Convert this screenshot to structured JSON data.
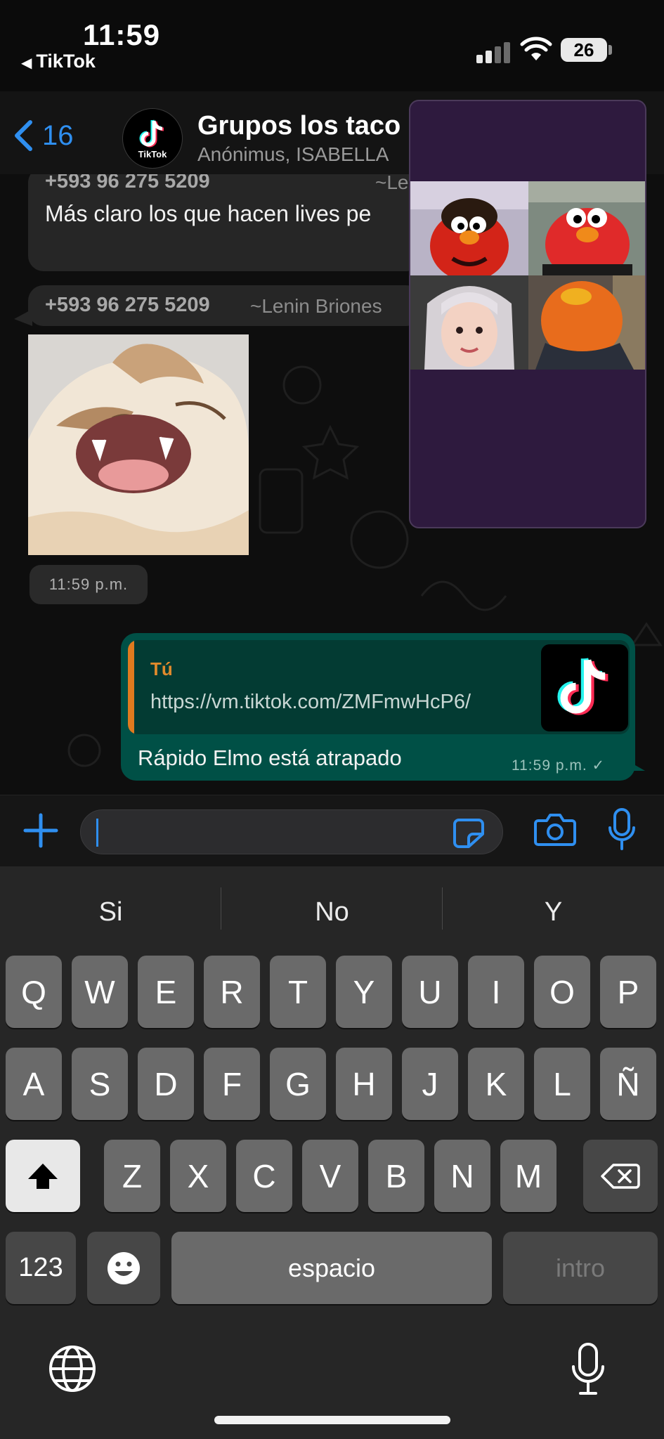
{
  "status_bar": {
    "time": "11:59",
    "back_app": "TikTok",
    "battery": "26"
  },
  "header": {
    "back_count": "16",
    "avatar_label": "TikTok",
    "title": "Grupos los taco",
    "subtitle": "Anónimus, ISABELLA"
  },
  "messages": {
    "msg1": {
      "sender": "+593 96 275 5209",
      "sender_name": "~Le",
      "text": "Más claro los que hacen lives pe"
    },
    "msg2": {
      "sender": "+593 96 275 5209",
      "sender_name": "~Lenin Briones"
    },
    "sticker_time": "11:59 p.m.",
    "outgoing": {
      "quote_author": "Tú",
      "quote_link": "https://vm.tiktok.com/ZMFmwHcP6/",
      "text": "Rápido Elmo está atrapado",
      "time": "11:59 p.m. ✓"
    }
  },
  "keyboard": {
    "suggestions": [
      "Si",
      "No",
      "Y"
    ],
    "row1": [
      "Q",
      "W",
      "E",
      "R",
      "T",
      "Y",
      "U",
      "I",
      "O",
      "P"
    ],
    "row2": [
      "A",
      "S",
      "D",
      "F",
      "G",
      "H",
      "J",
      "K",
      "L",
      "Ñ"
    ],
    "row3": [
      "Z",
      "X",
      "C",
      "V",
      "B",
      "N",
      "M"
    ],
    "numbers_label": "123",
    "space_label": "espacio",
    "return_label": "intro"
  },
  "icons": {
    "back": "chevron-left-icon",
    "plus": "plus-icon",
    "sticker": "sticker-icon",
    "camera": "camera-icon",
    "mic": "microphone-icon",
    "shift": "shift-icon",
    "delete": "backspace-icon",
    "emoji": "emoji-icon",
    "globe": "globe-icon",
    "dictation": "dictation-icon"
  },
  "colors": {
    "accent": "#2f8ff0",
    "outgoing_bubble": "#005046",
    "quote_bar": "#e07a1f",
    "overlay": "#2e1a3e"
  }
}
